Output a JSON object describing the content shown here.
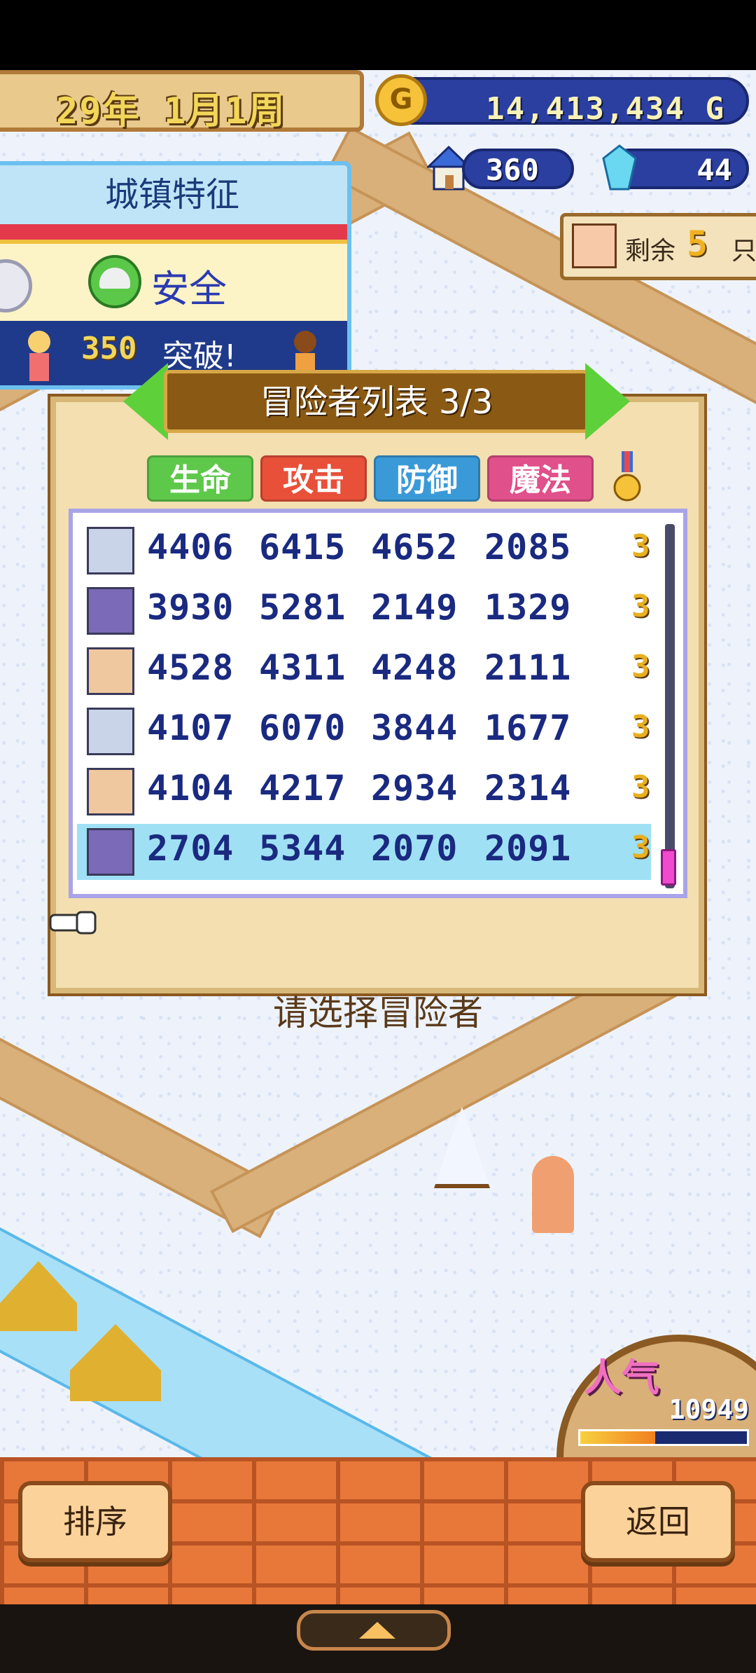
{
  "status": {
    "year": "29年",
    "date": "1月1周",
    "money": "14,413,434 G",
    "coin_symbol": "G",
    "population": "360",
    "gems": "44",
    "remaining_label": "剩余",
    "remaining_count": "5",
    "remaining_unit": "只"
  },
  "town_feature": {
    "title": "城镇特征",
    "value": "安全",
    "breakthrough_count": "350",
    "breakthrough_label": "突破!"
  },
  "adventurer_list": {
    "title": "冒险者列表 3/3",
    "columns": [
      "生命",
      "攻击",
      "防御",
      "魔法"
    ],
    "column_colors": [
      "#5ec84a",
      "#e8503a",
      "#3a9ad8",
      "#e0508a"
    ],
    "rows": [
      {
        "hp": "4406",
        "atk": "6415",
        "def": "4652",
        "mag": "2085",
        "level": "3",
        "avatar": "robot-icon",
        "selected": false
      },
      {
        "hp": "3930",
        "atk": "5281",
        "def": "2149",
        "mag": "1329",
        "level": "3",
        "avatar": "ninja-icon",
        "selected": false
      },
      {
        "hp": "4528",
        "atk": "4311",
        "def": "4248",
        "mag": "2111",
        "level": "3",
        "avatar": "samurai-icon",
        "selected": false
      },
      {
        "hp": "4107",
        "atk": "6070",
        "def": "3844",
        "mag": "1677",
        "level": "3",
        "avatar": "robot-icon",
        "selected": false
      },
      {
        "hp": "4104",
        "atk": "4217",
        "def": "2934",
        "mag": "2314",
        "level": "3",
        "avatar": "samurai-icon",
        "selected": false
      },
      {
        "hp": "2704",
        "atk": "5344",
        "def": "2070",
        "mag": "2091",
        "level": "3",
        "avatar": "ninja-icon",
        "selected": true
      }
    ],
    "prompt": "请选择冒险者"
  },
  "popularity": {
    "label": "人气",
    "value": "10949",
    "gauge_fraction": 0.45
  },
  "buttons": {
    "sort": "排序",
    "back": "返回"
  }
}
